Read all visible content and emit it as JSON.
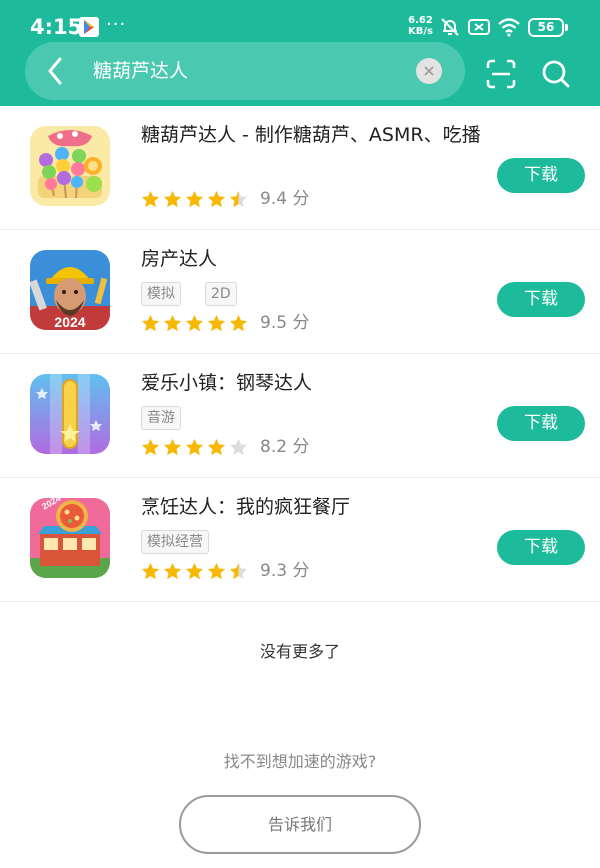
{
  "status_bar": {
    "time": "4:15",
    "more_dots": "···",
    "net_speed_value": "6.62",
    "net_speed_unit": "KB/s",
    "battery": "56",
    "icons": [
      "google-play-icon",
      "mute-bell-icon",
      "sim-off-icon",
      "wifi-icon",
      "battery-icon"
    ]
  },
  "search": {
    "query": "糖葫芦达人",
    "icons": [
      "back-arrow-icon",
      "clear-icon",
      "scan-icon",
      "search-icon"
    ]
  },
  "colors": {
    "accent": "#1dbb9b",
    "star": "#f8b800",
    "star_empty": "#dddddd"
  },
  "results": [
    {
      "title": "糖葫芦达人 - 制作糖葫芦、ASMR、吃播",
      "tags": [],
      "rating": 4.5,
      "score": "9.4 分",
      "download_label": "下载"
    },
    {
      "title": "房产达人",
      "tags": [
        "模拟",
        "2D"
      ],
      "rating": 5,
      "score": "9.5 分",
      "download_label": "下载",
      "icon_badge": "2024"
    },
    {
      "title": "爱乐小镇：钢琴达人",
      "tags": [
        "音游"
      ],
      "rating": 4,
      "score": "8.2 分",
      "download_label": "下载"
    },
    {
      "title": "烹饪达人：我的疯狂餐厅",
      "tags": [
        "模拟经营"
      ],
      "rating": 4.5,
      "score": "9.3 分",
      "download_label": "下载",
      "icon_badge": "2024"
    }
  ],
  "footer": {
    "no_more": "没有更多了",
    "not_found": "找不到想加速的游戏?",
    "tell_us": "告诉我们"
  }
}
